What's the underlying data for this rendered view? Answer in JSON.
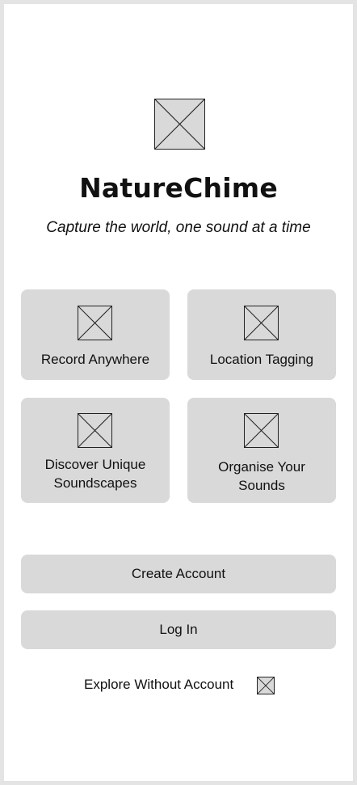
{
  "app": {
    "title": "NatureChime",
    "tagline": "Capture the world, one sound at a time"
  },
  "features": [
    {
      "label": "Record Anywhere",
      "icon": "image-placeholder-icon"
    },
    {
      "label": "Location Tagging",
      "icon": "image-placeholder-icon"
    },
    {
      "label_lines": [
        "Discover Unique",
        "Soundscapes"
      ],
      "icon": "image-placeholder-icon"
    },
    {
      "label_lines": [
        "Organise Your",
        "Sounds"
      ],
      "icon": "image-placeholder-icon"
    }
  ],
  "buttons": {
    "create_account": "Create Account",
    "log_in": "Log In"
  },
  "explore": {
    "label": "Explore Without Account",
    "icon": "image-placeholder-icon"
  },
  "colors": {
    "background": "#ffffff",
    "frame": "#e4e4e4",
    "card": "#d9d9d9",
    "placeholder_stroke": "#222222"
  }
}
